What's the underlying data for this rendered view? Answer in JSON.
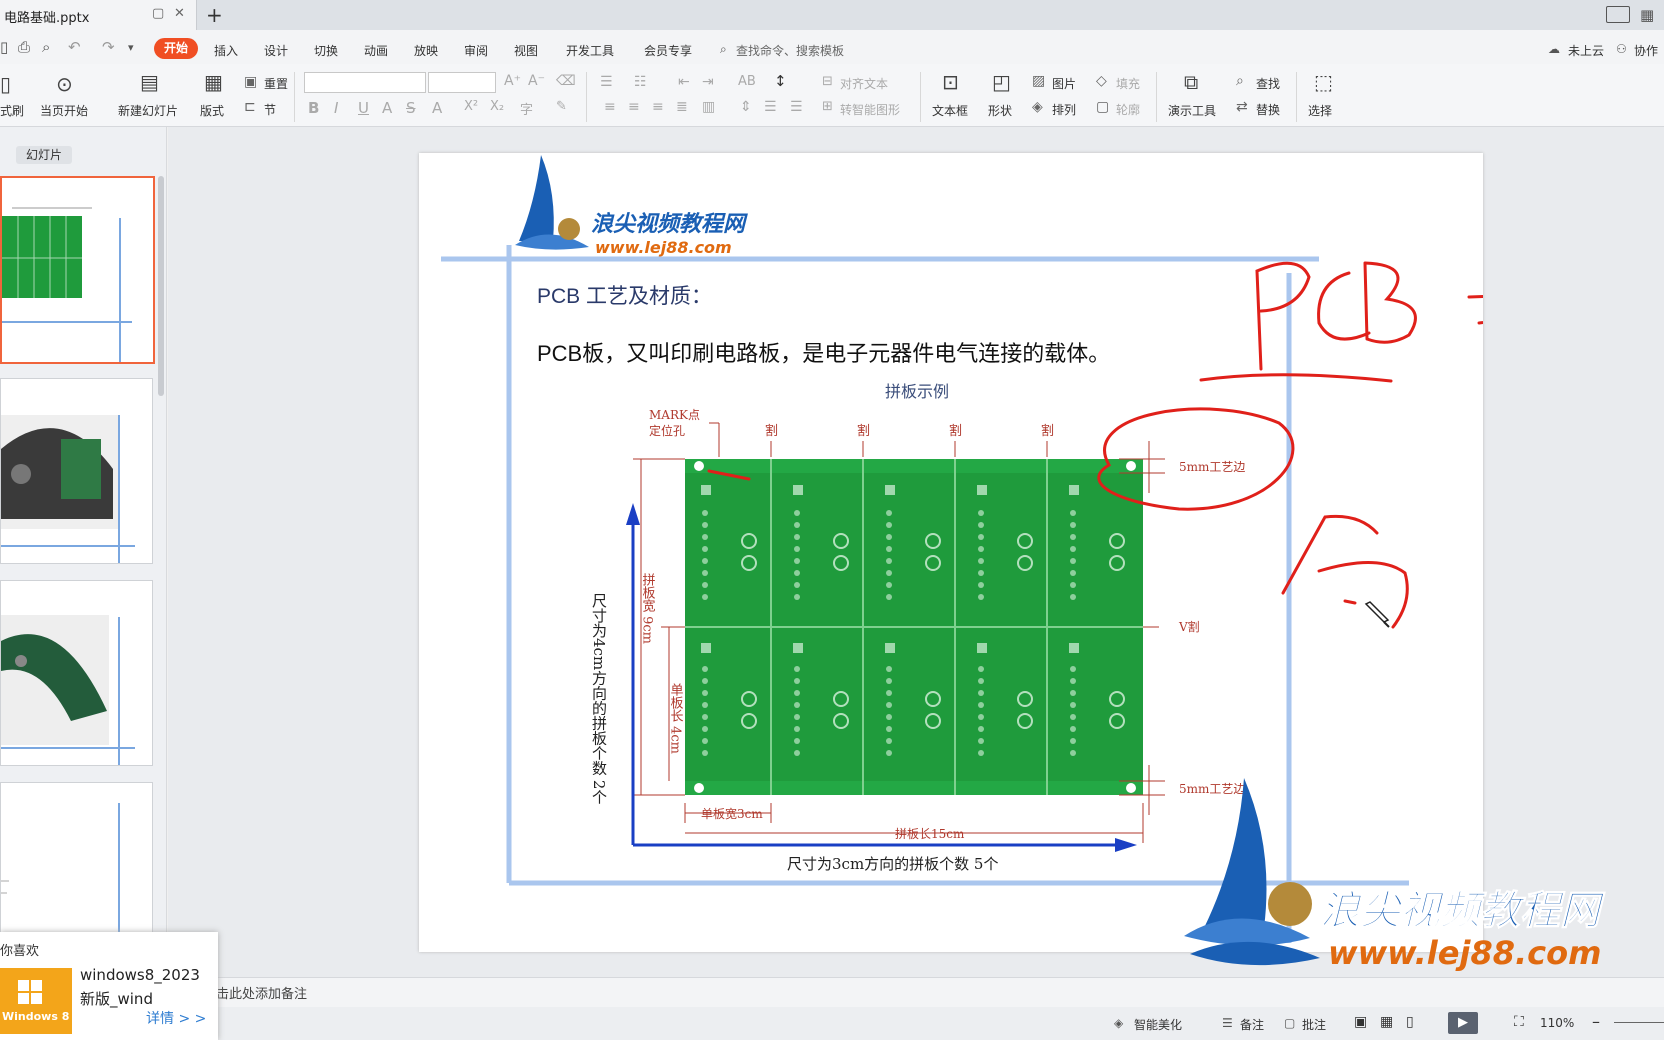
{
  "window": {
    "filename": "电路基础.pptx",
    "new_tab": "+"
  },
  "menu": {
    "items": [
      "开始",
      "插入",
      "设计",
      "切换",
      "动画",
      "放映",
      "审阅",
      "视图",
      "开发工具",
      "会员专享"
    ],
    "search_placeholder": "查找命令、搜索模板",
    "cloud": "未上云",
    "collab": "协作"
  },
  "ribbon": {
    "format_painter": "式刷",
    "from_current": "当页开始",
    "new_slide": "新建幻灯片",
    "layout": "版式",
    "reset": "重置",
    "section": "节",
    "align_text": "对齐文本",
    "smart_art": "转智能图形",
    "textbox": "文本框",
    "shapes": "形状",
    "picture": "图片",
    "arrange": "排列",
    "fill": "填充",
    "outline": "轮廓",
    "presenter_tools": "演示工具",
    "find": "查找",
    "replace": "替换",
    "select": "选择"
  },
  "left_panel": {
    "tab_label": "幻灯片"
  },
  "slide": {
    "logo_cn": "浪尖视频教程网",
    "logo_url": "www.lej88.com",
    "heading": "PCB 工艺及材质：",
    "body": "PCB板，又叫印刷电路板，是电子元器件电气连接的载体。",
    "diagram": {
      "title": "拼板示例",
      "mark_label_1": "MARK点",
      "mark_label_2": "定位孔",
      "cut_label": "割",
      "edge_top": "5mm工艺边",
      "edge_bottom": "5mm工艺边",
      "v_cut": "V割",
      "panel_width": "拼板宽 9cm",
      "single_length": "单板长 4cm",
      "single_width": "单板宽3cm",
      "panel_length": "拼板长15cm",
      "y_caption": "尺寸为4cm方向的拼板个数 2个",
      "x_caption": "尺寸为3cm方向的拼板个数 5个"
    },
    "handwriting": "PCB 拼板"
  },
  "watermark": {
    "cn": "浪尖视频教程网",
    "url": "www.lej88.com"
  },
  "notes": {
    "placeholder": "击此处添加备注"
  },
  "status": {
    "beautify": "智能美化",
    "notes": "备注",
    "comments": "批注",
    "zoom": "110%"
  },
  "popup": {
    "title": "你喜欢",
    "logo_label": "Windows 8",
    "line1": "windows8_2023",
    "line2": "新版_wind",
    "link": "详情 > >"
  },
  "colors": {
    "accent": "#f04e23",
    "pcb_green": "#1f9b3c",
    "diagram_red": "#c0392b",
    "ink_red": "#e0201a",
    "logo_blue": "#1a5fb4"
  }
}
